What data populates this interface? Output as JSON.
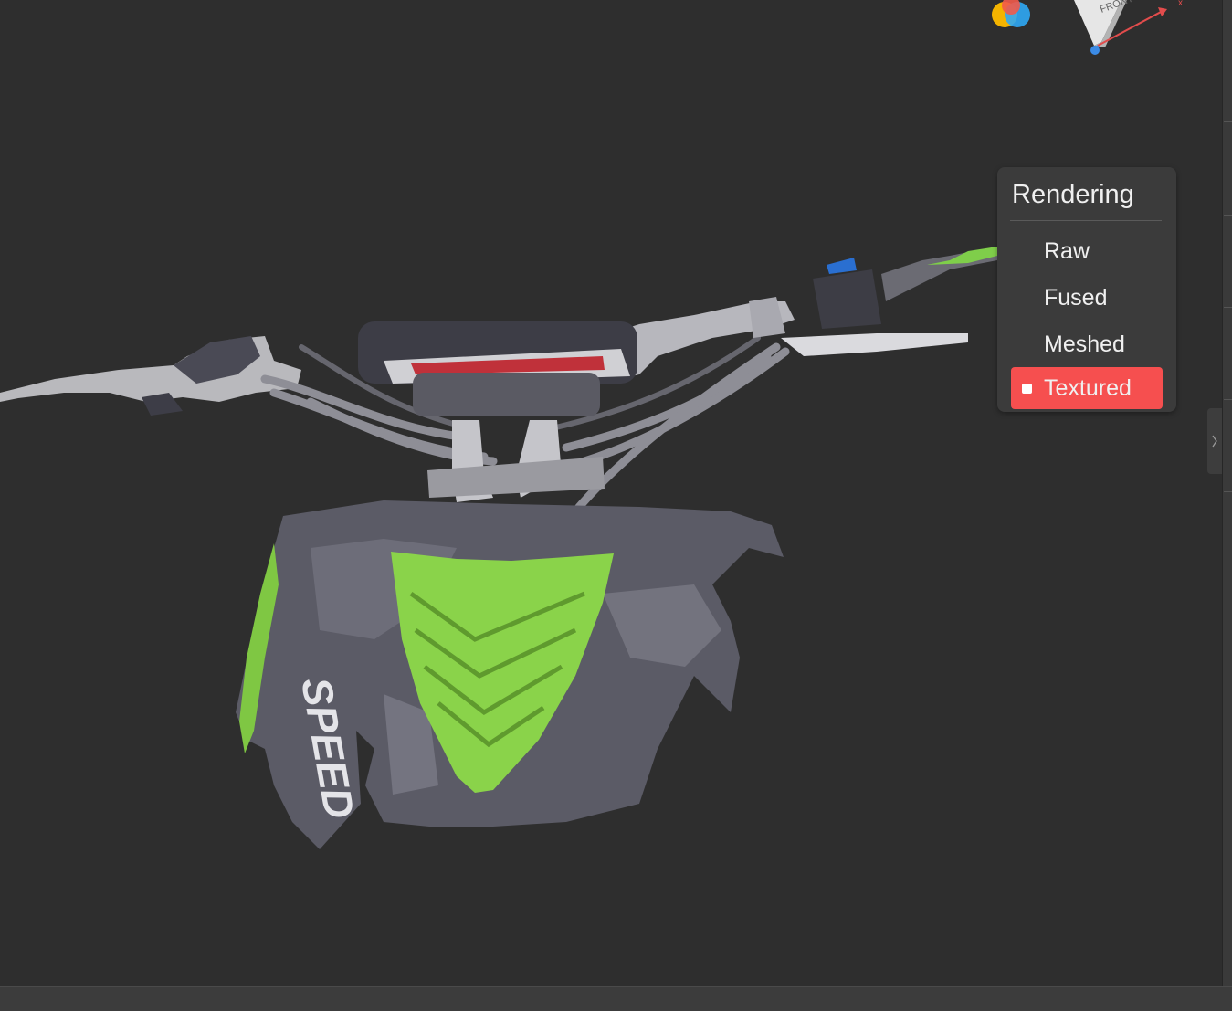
{
  "viewer": {
    "gizmo_face_label": "FRONT",
    "gizmo_axis_x_label": "x",
    "model_decal_text": "SPEED"
  },
  "rendering_panel": {
    "title": "Rendering",
    "options": [
      {
        "label": "Raw",
        "active": false
      },
      {
        "label": "Fused",
        "active": false
      },
      {
        "label": "Meshed",
        "active": false
      },
      {
        "label": "Textured",
        "active": true
      }
    ]
  },
  "icons": {
    "logo": "app-logo-icon",
    "gizmo": "orientation-cube-icon",
    "collapse": "chevron-right-icon"
  },
  "colors": {
    "viewport_bg": "#2e2e2e",
    "panel_bg": "#3b3b3b",
    "active_option": "#f64f4f",
    "model_green": "#8ad34a"
  }
}
